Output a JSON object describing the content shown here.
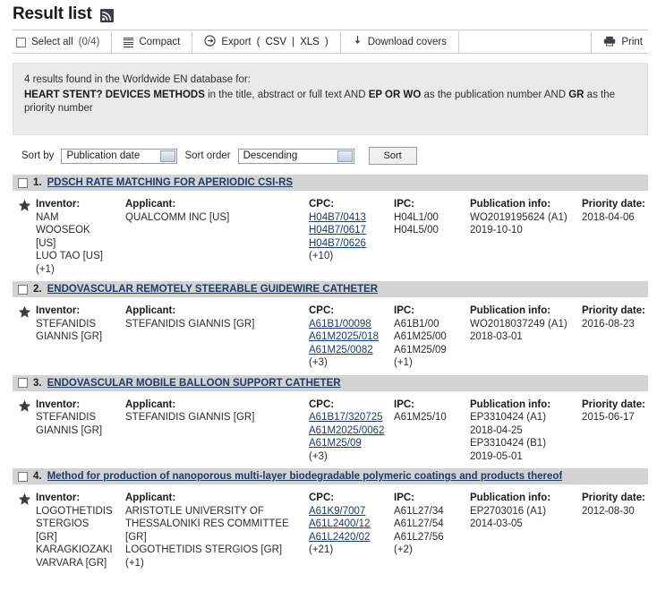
{
  "header": {
    "title": "Result list",
    "rss_icon": "rss-feed-icon"
  },
  "toolbar": {
    "select_all_label": "Select all",
    "select_all_count": "(0/4)",
    "compact_label": "Compact",
    "export_label": "Export",
    "export_open_paren": "(",
    "export_csv": "CSV",
    "export_pipe": "|",
    "export_xls": "XLS",
    "export_close_paren": ")",
    "download_covers_label": "Download covers",
    "print_label": "Print"
  },
  "banner": {
    "line1": "4 results found in the Worldwide EN database for:",
    "query_bold_1": "HEART STENT? DEVICES METHODS",
    "query_plain_1": " in the title, abstract or full text AND ",
    "query_bold_2": "EP OR WO",
    "query_plain_2": " as the publication number AND ",
    "query_bold_3": "GR",
    "query_plain_3": " as the priority number"
  },
  "sort": {
    "sort_by_label": "Sort by",
    "sort_by_value": "Publication date",
    "sort_order_label": "Sort order",
    "sort_order_value": "Descending",
    "sort_button_label": "Sort"
  },
  "columns": {
    "inventor": "Inventor:",
    "applicant": "Applicant:",
    "cpc": "CPC:",
    "ipc": "IPC:",
    "publication_info": "Publication info:",
    "priority_date": "Priority date:"
  },
  "results": [
    {
      "num": "1.",
      "title": "PDSCH RATE MATCHING FOR APERIODIC CSI-RS",
      "inventors": [
        "NAM",
        "WOOSEOK",
        "[US]",
        "LUO TAO  [US]",
        "(+1)"
      ],
      "applicants": [
        "QUALCOMM INC  [US]"
      ],
      "cpc": [
        "H04B7/0413",
        "H04B7/0617",
        "H04B7/0626"
      ],
      "cpc_more": "(+10)",
      "ipc": [
        "H04L1/00",
        "H04L5/00"
      ],
      "ipc_more": "",
      "publication": [
        "WO2019195624 (A1)",
        "2019-10-10"
      ],
      "priority": "2018-04-06"
    },
    {
      "num": "2.",
      "title": "ENDOVASCULAR REMOTELY STEERABLE GUIDEWIRE CATHETER",
      "inventors": [
        "STEFANIDIS",
        "GIANNIS  [GR]"
      ],
      "applicants": [
        "STEFANIDIS GIANNIS  [GR]"
      ],
      "cpc": [
        "A61B1/00098",
        "A61M2025/018",
        "A61M25/0082"
      ],
      "cpc_more": "(+3)",
      "ipc": [
        "A61B1/00",
        "A61M25/00",
        "A61M25/09"
      ],
      "ipc_more": "(+1)",
      "publication": [
        "WO2018037249 (A1)",
        "2018-03-01"
      ],
      "priority": "2016-08-23"
    },
    {
      "num": "3.",
      "title": "ENDOVASCULAR MOBILE BALLOON SUPPORT CATHETER",
      "inventors": [
        "STEFANIDIS",
        "GIANNIS  [GR]"
      ],
      "applicants": [
        "STEFANIDIS GIANNIS  [GR]"
      ],
      "cpc": [
        "A61B17/320725",
        "A61M2025/0062",
        "A61M25/09"
      ],
      "cpc_more": "(+3)",
      "ipc": [
        "A61M25/10"
      ],
      "ipc_more": "",
      "publication": [
        "EP3310424 (A1)",
        "2018-04-25",
        "EP3310424 (B1)",
        "2019-05-01"
      ],
      "priority": "2015-06-17"
    },
    {
      "num": "4.",
      "title": "Method for production of nanoporous multi-layer biodegradable polymeric coatings and products thereof",
      "inventors": [
        "LOGOTHETIDIS",
        "STERGIOS",
        "[GR]",
        "KARAGKIOZAKI",
        "VARVARA  [GR]"
      ],
      "applicants": [
        "ARISTOTLE UNIVERSITY OF",
        "THESSALONIKI RES COMMITTEE",
        "[GR]",
        "LOGOTHETIDIS STERGIOS  [GR]",
        "(+1)"
      ],
      "cpc": [
        "A61K9/7007",
        "A61L2400/12",
        "A61L2420/02"
      ],
      "cpc_more": "(+21)",
      "ipc": [
        "A61L27/34",
        "A61L27/54",
        "A61L27/56"
      ],
      "ipc_more": "(+2)",
      "publication": [
        "EP2703016 (A1)",
        "2014-03-05"
      ],
      "priority": "2012-08-30"
    }
  ],
  "colors": {
    "link": "#1a3c6e",
    "banner_bg": "#eaeaea",
    "row_header_bg": "#d3d3d3",
    "icon_dark": "#3a3f45"
  }
}
